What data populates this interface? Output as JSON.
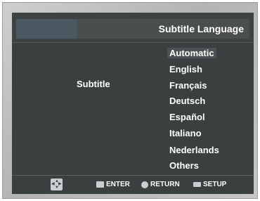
{
  "header": {
    "title": "Subtitle Language"
  },
  "setting": {
    "label": "Subtitle"
  },
  "options": [
    {
      "label": "Automatic",
      "selected": true
    },
    {
      "label": "English"
    },
    {
      "label": "Français"
    },
    {
      "label": "Deutsch"
    },
    {
      "label": "Español"
    },
    {
      "label": "Italiano"
    },
    {
      "label": "Nederlands"
    },
    {
      "label": "Others"
    }
  ],
  "footer": {
    "nav_icon": "four-way-arrows-icon",
    "enter_icon": "enter-icon",
    "enter_label": "ENTER",
    "return_icon": "return-icon",
    "return_label": "RETURN",
    "setup_icon": "setup-icon",
    "setup_label": "SETUP"
  }
}
